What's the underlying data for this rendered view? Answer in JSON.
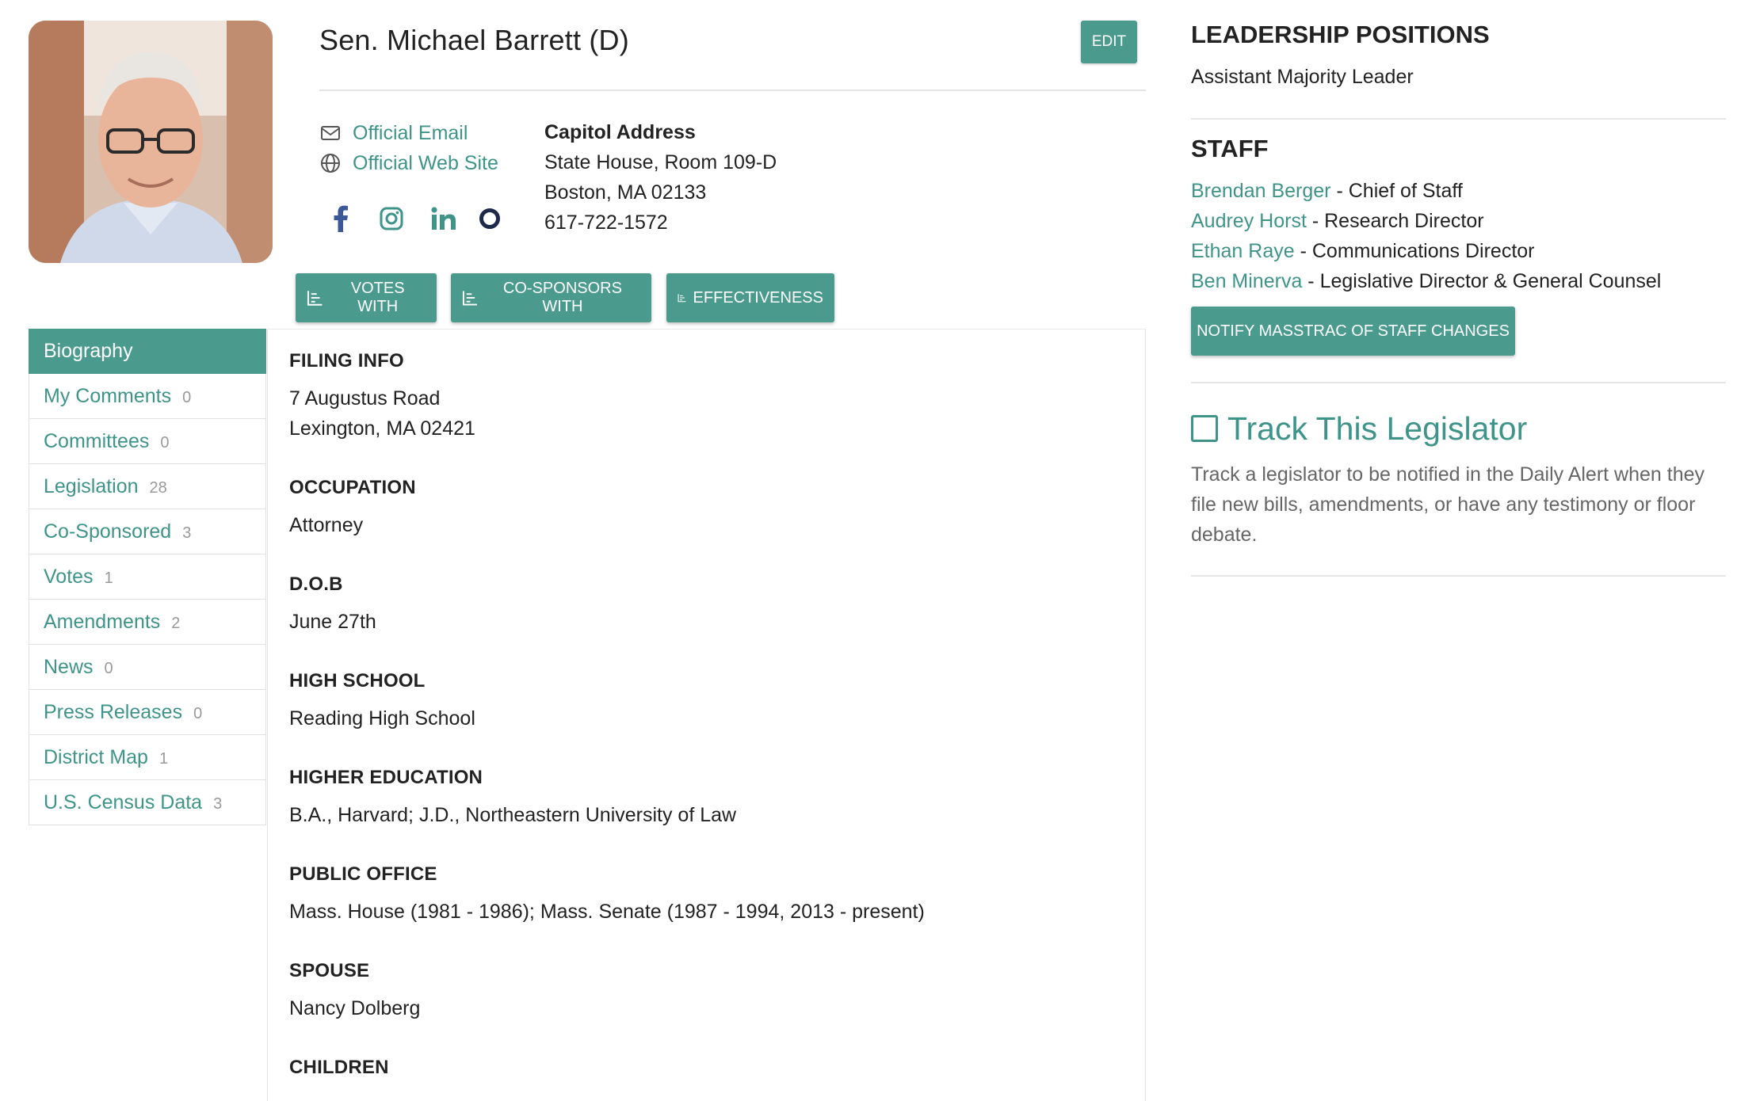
{
  "header": {
    "name": "Sen. Michael Barrett (D)",
    "edit_label": "EDIT"
  },
  "contact": {
    "email_label": "Official Email",
    "website_label": "Official Web Site",
    "capitol_label": "Capitol Address",
    "capitol_lines": [
      "State House, Room 109-D",
      "Boston, MA 02133",
      "617-722-1572"
    ]
  },
  "social": [
    "facebook-icon",
    "instagram-icon",
    "linkedin-icon",
    "o-icon"
  ],
  "actions": {
    "votes_with": "VOTES WITH",
    "cosponsors_with": "CO-SPONSORS WITH",
    "effectiveness": "EFFECTIVENESS"
  },
  "sidebar": {
    "items": [
      {
        "label": "Biography",
        "count": ""
      },
      {
        "label": "My Comments",
        "count": "0"
      },
      {
        "label": "Committees",
        "count": "0"
      },
      {
        "label": "Legislation",
        "count": "28"
      },
      {
        "label": "Co-Sponsored",
        "count": "3"
      },
      {
        "label": "Votes",
        "count": "1"
      },
      {
        "label": "Amendments",
        "count": "2"
      },
      {
        "label": "News",
        "count": "0"
      },
      {
        "label": "Press Releases",
        "count": "0"
      },
      {
        "label": "District Map",
        "count": "1"
      },
      {
        "label": "U.S. Census Data",
        "count": "3"
      }
    ]
  },
  "bio": {
    "filing_info": {
      "heading": "FILING INFO",
      "lines": [
        "7 Augustus Road",
        "Lexington, MA 02421"
      ]
    },
    "occupation": {
      "heading": "OCCUPATION",
      "value": "Attorney"
    },
    "dob": {
      "heading": "D.O.B",
      "value": "June 27th"
    },
    "high_school": {
      "heading": "HIGH SCHOOL",
      "value": "Reading High School"
    },
    "higher_education": {
      "heading": "HIGHER EDUCATION",
      "value": "B.A., Harvard; J.D., Northeastern University of Law"
    },
    "public_office": {
      "heading": "PUBLIC OFFICE",
      "value": "Mass. House (1981 - 1986); Mass. Senate (1987 - 1994, 2013 - present)"
    },
    "spouse": {
      "heading": "SPOUSE",
      "value": "Nancy Dolberg"
    },
    "children": {
      "heading": "CHILDREN"
    }
  },
  "right": {
    "leadership_heading": "LEADERSHIP POSITIONS",
    "leadership_value": "Assistant Majority Leader",
    "staff_heading": "STAFF",
    "staff": [
      {
        "name": "Brendan Berger",
        "role": " - Chief of Staff"
      },
      {
        "name": "Audrey Horst",
        "role": " - Research Director"
      },
      {
        "name": "Ethan Raye",
        "role": " - Communications Director"
      },
      {
        "name": "Ben Minerva",
        "role": " - Legislative Director & General Counsel"
      }
    ],
    "notify_label": "NOTIFY MASSTRAC OF STAFF CHANGES",
    "track_label": "Track This Legislator",
    "track_desc": "Track a legislator to be notified in the Daily Alert when they file new bills, amendments, or have any testimony or floor debate."
  },
  "colors": {
    "accent": "#4a9a8e",
    "link": "#3f948a"
  }
}
